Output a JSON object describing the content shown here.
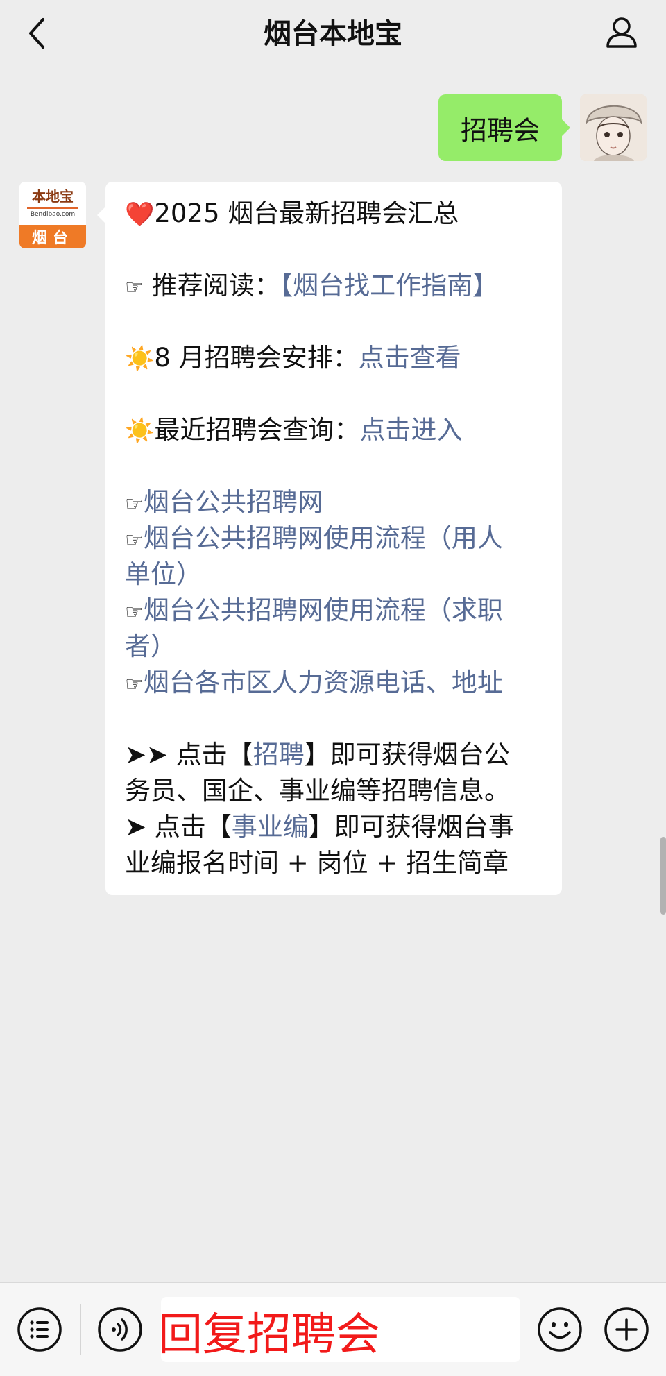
{
  "header": {
    "title": "烟台本地宝",
    "back_icon": "chevron-left-icon",
    "profile_icon": "person-icon"
  },
  "messages": {
    "user_message": "招聘会",
    "bot_avatar": {
      "brand": "本地宝",
      "url": "Bendibao.com",
      "city": "烟台"
    },
    "bot": {
      "line1_emoji": "❤️",
      "line1_text": "2025 烟台最新招聘会汇总",
      "hand": "☞",
      "sun": "☀️",
      "line2_text": " 推荐阅读：",
      "line2_link": "【烟台找工作指南】",
      "line3_text": "8 月招聘会安排：",
      "line3_link": "点击查看",
      "line4_text": "最近招聘会查询：",
      "line4_link": "点击进入",
      "link5": "烟台公共招聘网",
      "link6a": "烟台公共招聘网使用流程（用人",
      "link6b": "单位）",
      "link7a": "烟台公共招聘网使用流程（求职",
      "link7b": "者）",
      "link8": "烟台各市区人力资源电话、地址",
      "arrows2": "➤➤",
      "arrow1": "➤",
      "p1_a": " 点击【",
      "p1_link": "招聘",
      "p1_b": "】即可获得烟台公",
      "p1_line2": "务员、国企、事业编等招聘信息。",
      "p2_a": " 点击【",
      "p2_link": "事业编",
      "p2_b": "】即可获得烟台事",
      "p2_line2": "业编报名时间 + 岗位 + 招生简章"
    }
  },
  "bottom_bar": {
    "menu_icon": "menu-list-icon",
    "voice_icon": "voice-icon",
    "emoji_icon": "emoji-icon",
    "plus_icon": "plus-icon",
    "overlay_text": "回复招聘会"
  },
  "colors": {
    "background": "#ededed",
    "user_bubble": "#95ec69",
    "link": "#576b95",
    "overlay_text": "#f21a1a",
    "bot_accent": "#ef7a26"
  }
}
